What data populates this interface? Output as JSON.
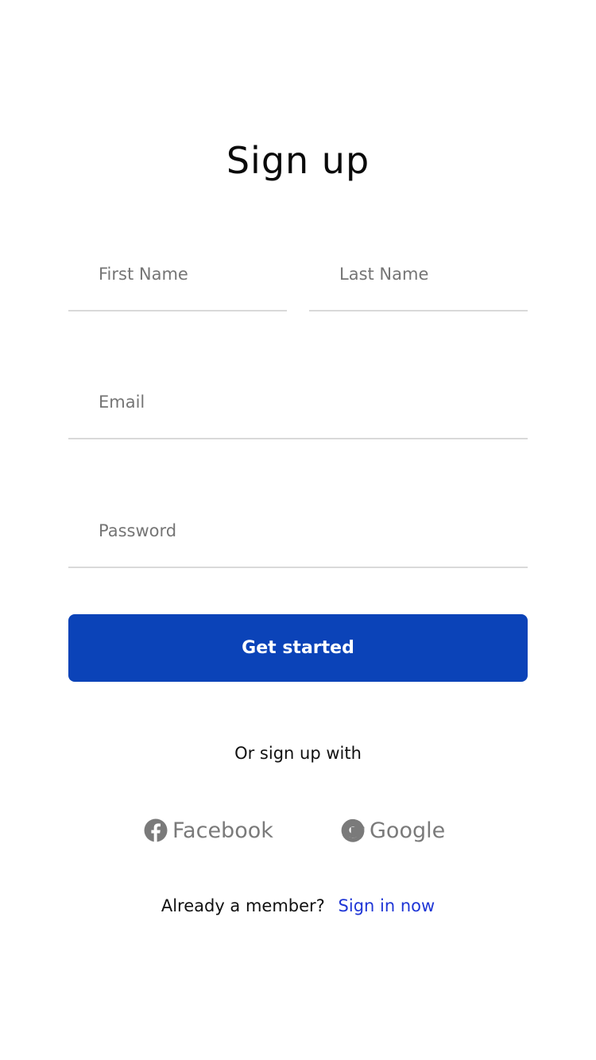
{
  "page": {
    "title": "Sign up"
  },
  "form": {
    "first_name": {
      "placeholder": "First Name",
      "value": ""
    },
    "last_name": {
      "placeholder": "Last Name",
      "value": ""
    },
    "email": {
      "placeholder": "Email",
      "value": ""
    },
    "password": {
      "placeholder": "Password",
      "value": ""
    },
    "submit_label": "Get started"
  },
  "social": {
    "prompt": "Or sign up with",
    "facebook_label": "Facebook",
    "facebook_icon": "facebook-icon",
    "google_label": "Google",
    "google_icon": "google-icon"
  },
  "footer": {
    "question": "Already a member?",
    "link": "Sign in now"
  },
  "colors": {
    "primary": "#0b43b8",
    "link": "#1f36d6",
    "muted": "#7a7a7a",
    "divider": "#d9d9d9"
  }
}
